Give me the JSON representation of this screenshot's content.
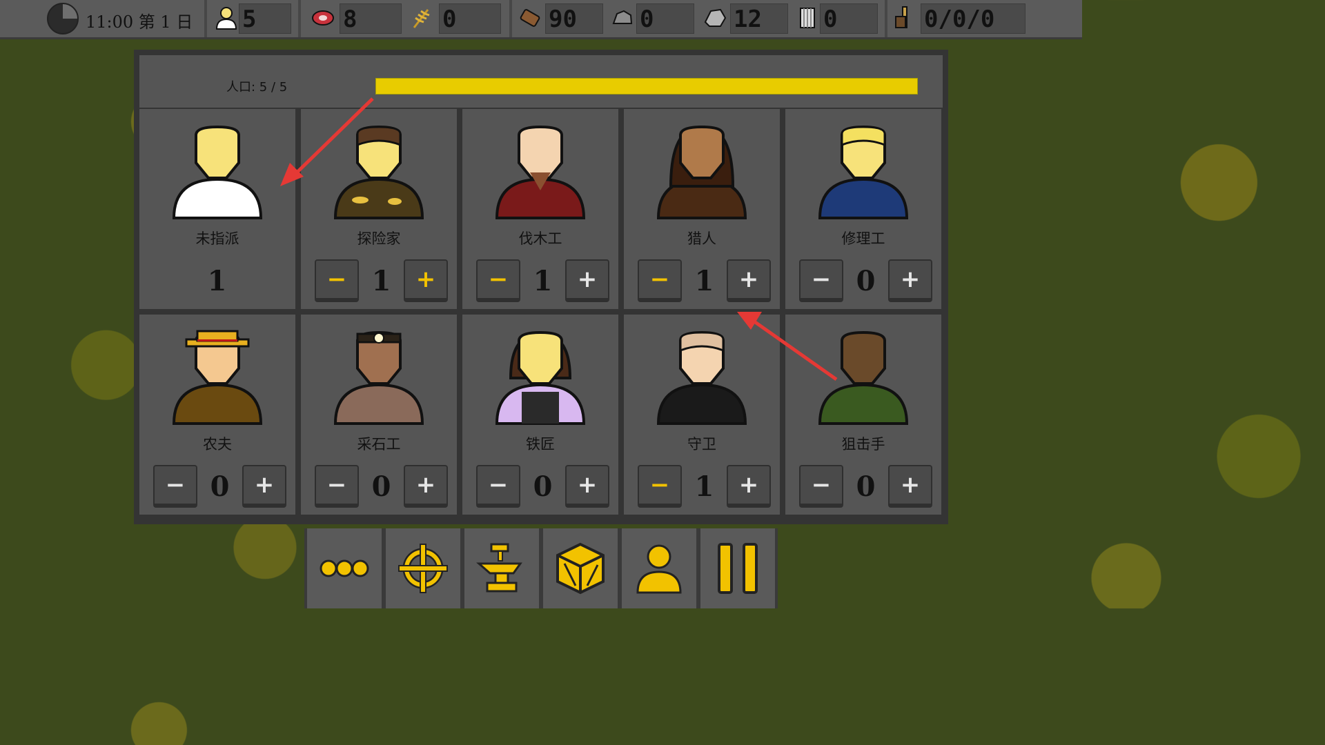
{
  "topbar": {
    "time_label": "11:00 第 1 日",
    "population": "5",
    "meat": "8",
    "wheat": "0",
    "wood": "90",
    "stone": "0",
    "iron": "12",
    "cloth": "0",
    "misc": "0/0/0"
  },
  "panel": {
    "population_label": "人口: 5 / 5",
    "population_fill_fraction": 1.0,
    "jobs": [
      {
        "name": "未指派",
        "count": "1",
        "adjustable": false,
        "portrait": "unassigned-portrait"
      },
      {
        "name": "探险家",
        "count": "1",
        "adjustable": true,
        "minus_active": true,
        "plus_active": true,
        "portrait": "explorer-portrait"
      },
      {
        "name": "伐木工",
        "count": "1",
        "adjustable": true,
        "minus_active": true,
        "plus_active": false,
        "portrait": "lumberjack-portrait"
      },
      {
        "name": "猎人",
        "count": "1",
        "adjustable": true,
        "minus_active": true,
        "plus_active": false,
        "portrait": "hunter-portrait"
      },
      {
        "name": "修理工",
        "count": "0",
        "adjustable": true,
        "minus_active": false,
        "plus_active": false,
        "portrait": "repairman-portrait"
      },
      {
        "name": "农夫",
        "count": "0",
        "adjustable": true,
        "minus_active": false,
        "plus_active": false,
        "portrait": "farmer-portrait"
      },
      {
        "name": "采石工",
        "count": "0",
        "adjustable": true,
        "minus_active": false,
        "plus_active": false,
        "portrait": "quarrier-portrait"
      },
      {
        "name": "铁匠",
        "count": "0",
        "adjustable": true,
        "minus_active": false,
        "plus_active": false,
        "portrait": "blacksmith-portrait"
      },
      {
        "name": "守卫",
        "count": "1",
        "adjustable": true,
        "minus_active": true,
        "plus_active": false,
        "portrait": "guard-portrait"
      },
      {
        "name": "狙击手",
        "count": "0",
        "adjustable": true,
        "minus_active": false,
        "plus_active": false,
        "portrait": "sniper-portrait"
      }
    ]
  },
  "toolbar": {
    "items": [
      "more-icon",
      "target-icon",
      "anvil-icon",
      "crate-icon",
      "person-icon",
      "pause-icon"
    ]
  },
  "colors": {
    "accent_yellow": "#f2c200",
    "progress_fill": "#e8cc00",
    "panel_bg": "#555555",
    "annotation_arrow": "#e53935"
  }
}
